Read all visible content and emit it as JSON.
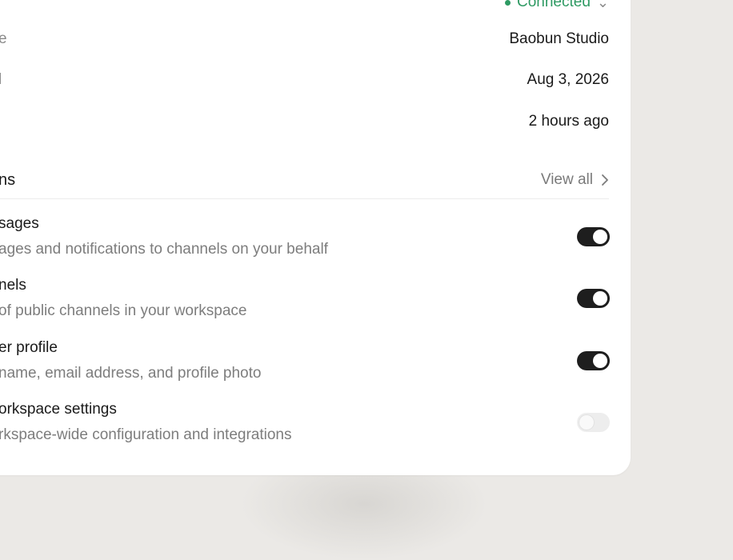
{
  "connection": {
    "status": "Connected"
  },
  "details": [
    {
      "label": "e",
      "value": "Baobun Studio"
    },
    {
      "label": "l",
      "value": "Aug 3, 2026"
    },
    {
      "label": "",
      "value": "2 hours ago"
    }
  ],
  "permissions": {
    "title": "ns",
    "view_all_label": "View all",
    "items": [
      {
        "title": "sages",
        "description": "ages and notifications to channels on your behalf",
        "enabled": true
      },
      {
        "title": "nels",
        "description": "of public channels in your workspace",
        "enabled": true
      },
      {
        "title": "er profile",
        "description": "name, email address, and profile photo",
        "enabled": true
      },
      {
        "title": "orkspace settings",
        "description": "rkspace-wide configuration and integrations",
        "enabled": false
      }
    ]
  }
}
